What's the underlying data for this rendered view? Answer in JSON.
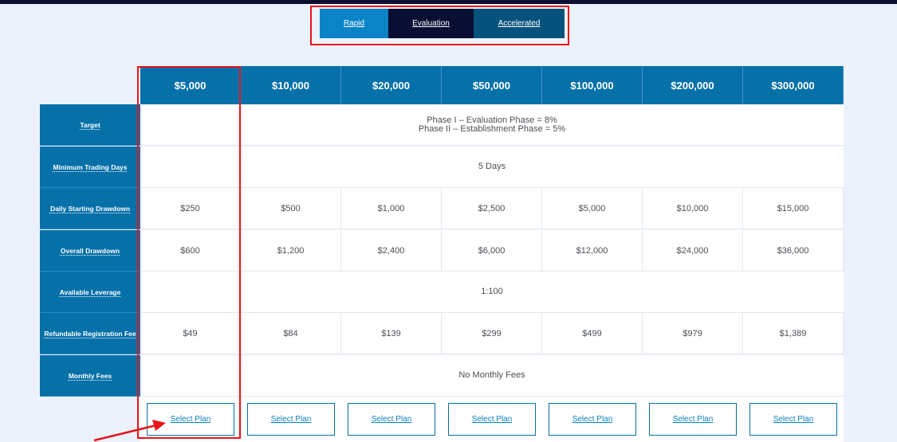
{
  "tabs": [
    {
      "label": "Rapid"
    },
    {
      "label": "Evaluation"
    },
    {
      "label": "Accelerated"
    }
  ],
  "plans": [
    "$5,000",
    "$10,000",
    "$20,000",
    "$50,000",
    "$100,000",
    "$200,000",
    "$300,000"
  ],
  "rows": {
    "target": {
      "label": "Target",
      "line1": "Phase I – Evaluation Phase = 8%",
      "line2": "Phase II – Establishment Phase = 5%"
    },
    "min_days": {
      "label": "Minimum Trading Days",
      "value": "5 Days"
    },
    "daily_drawdown": {
      "label": "Daily Starting Drawdown",
      "values": [
        "$250",
        "$500",
        "$1,000",
        "$2,500",
        "$5,000",
        "$10,000",
        "$15,000"
      ]
    },
    "overall_drawdown": {
      "label": "Overall Drawdown",
      "values": [
        "$600",
        "$1,200",
        "$2,400",
        "$6,000",
        "$12,000",
        "$24,000",
        "$36,000"
      ]
    },
    "leverage": {
      "label": "Available Leverage",
      "value": "1:100"
    },
    "registration_fee": {
      "label": "Refundable Registration Fee",
      "values": [
        "$49",
        "$84",
        "$139",
        "$299",
        "$499",
        "$979",
        "$1,389"
      ]
    },
    "monthly_fees": {
      "label": "Monthly Fees",
      "value": "No Monthly Fees"
    }
  },
  "select_label": "Select Plan",
  "colors": {
    "header_blue": "#0670a9",
    "highlight_red": "#e8141a",
    "tab_active": "#0a0e33"
  }
}
